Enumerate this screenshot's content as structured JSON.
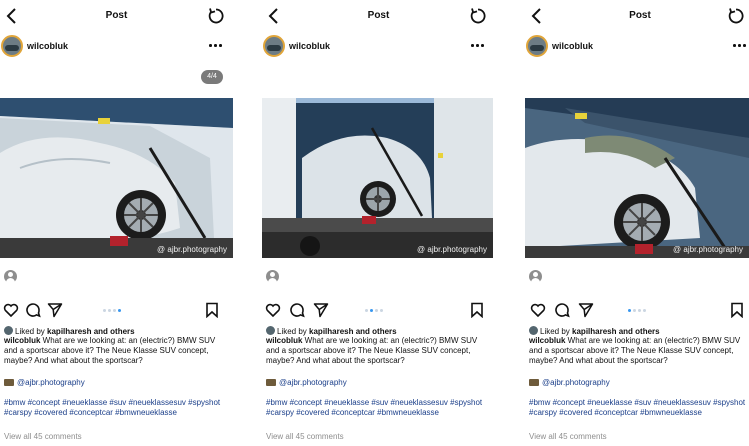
{
  "header": {
    "title": "Post"
  },
  "post": {
    "username": "wilcobluk",
    "image_counter": "4/4",
    "watermark": "@ ajbr.photography",
    "liked_by_prefix": "Liked by ",
    "liked_by_user": "kapilharesh",
    "liked_by_suffix": " and others",
    "caption_user": "wilcobluk",
    "caption_text": " What are we looking at: an (electric?) BMW SUV and a sportscar above it? The Neue Klasse SUV concept, maybe? And what about the sportscar?",
    "credit": "@ajbr.photography",
    "hashtags": "#bmw #concept #neueklasse #suv #neueklassesuv #spyshot #carspy #covered #conceptcar #bmwneueklasse",
    "comments_link": "View all 45 comments"
  },
  "icons": {
    "back": "chevron-left-icon",
    "refresh": "refresh-icon",
    "more": "more-horizontal-icon",
    "like": "heart-icon",
    "comment": "comment-icon",
    "share": "send-icon",
    "save": "bookmark-icon",
    "tag": "user-tag-icon"
  },
  "colors": {
    "link": "#1b3f8a",
    "active_dot": "#3897f0",
    "avatar_ring": "#e0a53a"
  },
  "carousel": {
    "total": 4,
    "active_by_panel": [
      4,
      2,
      1
    ]
  }
}
